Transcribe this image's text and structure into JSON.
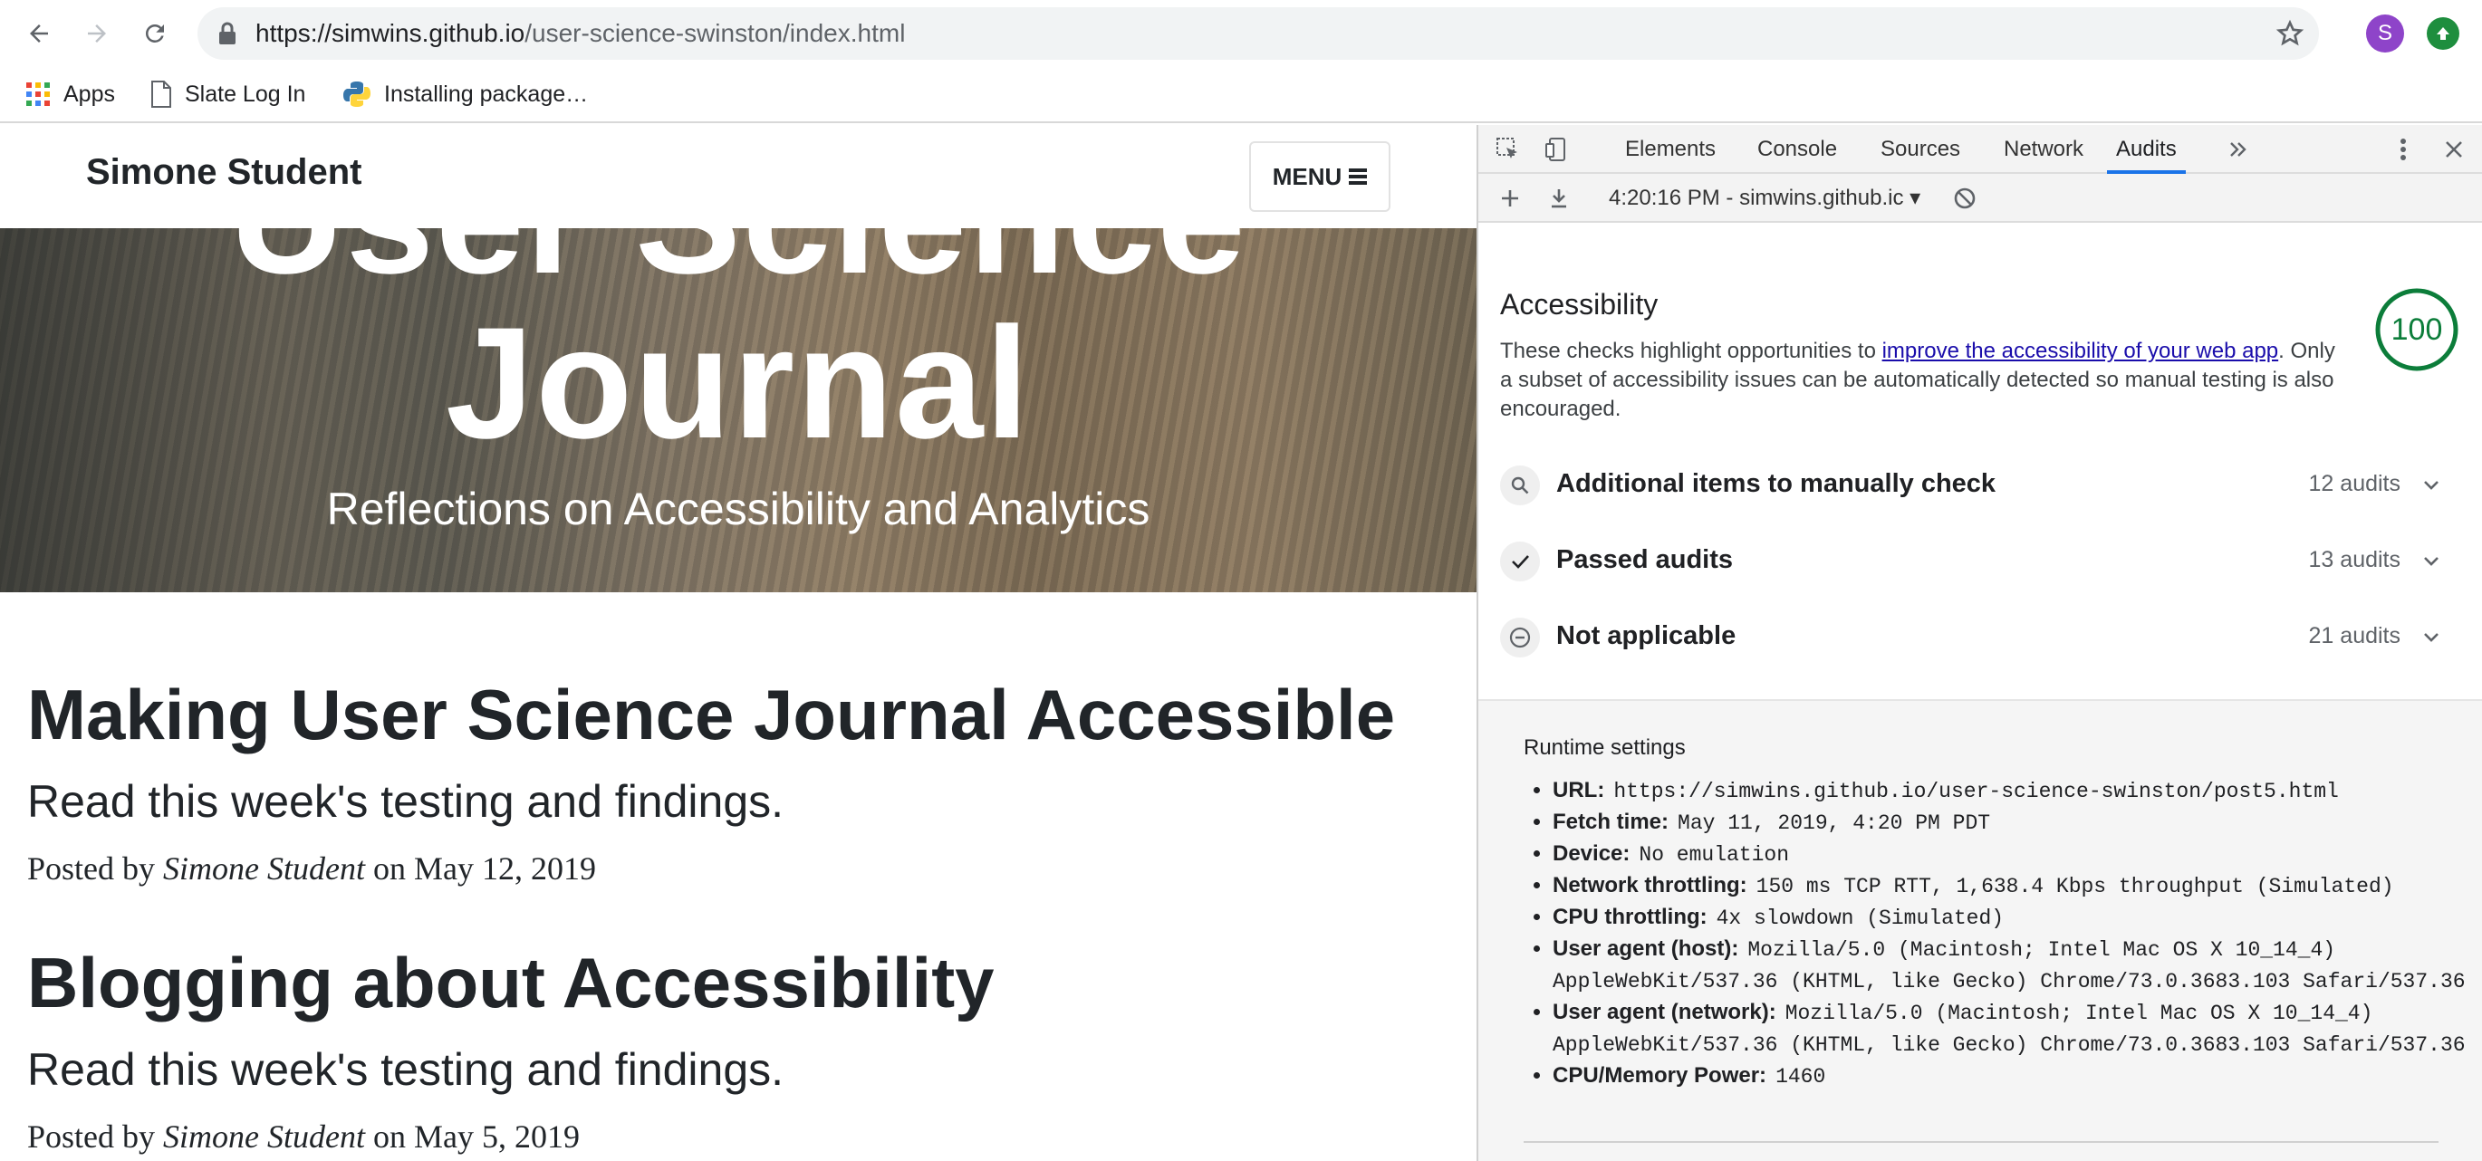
{
  "browser": {
    "url": {
      "host": "https://simwins.github.io",
      "path": "/user-science-swinston/index.html"
    },
    "avatar_letter": "S",
    "bookmarks": [
      {
        "label": "Apps",
        "icon": "apps-grid-icon"
      },
      {
        "label": "Slate Log In",
        "icon": "document-icon"
      },
      {
        "label": "Installing package…",
        "icon": "python-icon"
      }
    ]
  },
  "page": {
    "brand": "Simone Student",
    "menu_label": "MENU",
    "hero": {
      "title_top": "User Science",
      "title": "Journal",
      "subtitle": "Reflections on Accessibility and Analytics"
    },
    "posts": [
      {
        "title": "Making User Science Journal Accessible",
        "subtitle": "Read this week's testing and findings.",
        "meta_prefix": "Posted by",
        "author": "Simone Student",
        "meta_on": "on",
        "date": "May 12, 2019"
      },
      {
        "title": "Blogging about Accessibility",
        "subtitle": "Read this week's testing and findings.",
        "meta_prefix": "Posted by",
        "author": "Simone Student",
        "meta_on": "on",
        "date": "May 5, 2019"
      }
    ]
  },
  "devtools": {
    "tabs": [
      "Elements",
      "Console",
      "Sources",
      "Network",
      "Audits"
    ],
    "active_tab": "Audits",
    "report_select": "4:20:16 PM - simwins.github.ic ▾",
    "accessibility": {
      "title": "Accessibility",
      "desc_before": "These checks highlight opportunities to ",
      "desc_link": "improve the accessibility of your web app",
      "desc_after": ". Only a subset of accessibility issues can be automatically detected so manual testing is also encouraged.",
      "score": "100",
      "score_color": "#0c7d3a"
    },
    "groups": [
      {
        "title": "Additional items to manually check",
        "count": "12 audits",
        "icon": "search-icon"
      },
      {
        "title": "Passed audits",
        "count": "13 audits",
        "icon": "check-icon"
      },
      {
        "title": "Not applicable",
        "count": "21 audits",
        "icon": "minus-circle-icon"
      }
    ],
    "runtime": {
      "title": "Runtime settings",
      "items": [
        {
          "key": "URL:",
          "value": "https://simwins.github.io/user-science-swinston/post5.html"
        },
        {
          "key": "Fetch time:",
          "value": "May 11, 2019, 4:20 PM PDT"
        },
        {
          "key": "Device:",
          "value": "No emulation"
        },
        {
          "key": "Network throttling:",
          "value": "150 ms TCP RTT, 1,638.4 Kbps throughput (Simulated)"
        },
        {
          "key": "CPU throttling:",
          "value": "4x slowdown (Simulated)"
        },
        {
          "key": "User agent (host):",
          "value": "Mozilla/5.0 (Macintosh; Intel Mac OS X 10_14_4) AppleWebKit/537.36 (KHTML, like Gecko) Chrome/73.0.3683.103 Safari/537.36"
        },
        {
          "key": "User agent (network):",
          "value": "Mozilla/5.0 (Macintosh; Intel Mac OS X 10_14_4) AppleWebKit/537.36 (KHTML, like Gecko) Chrome/73.0.3683.103 Safari/537.36"
        },
        {
          "key": "CPU/Memory Power:",
          "value": "1460"
        }
      ]
    }
  }
}
